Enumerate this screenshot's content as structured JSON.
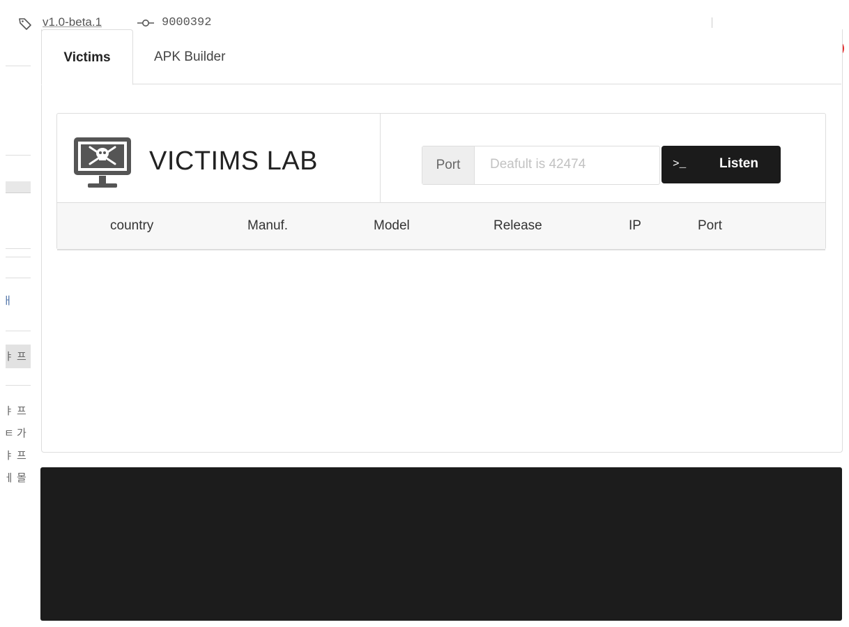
{
  "topbar": {
    "tag_icon": "tag-icon",
    "version": "v1.0-beta.1",
    "commit_icon": "git-commit-icon",
    "commit": "9000392"
  },
  "window_controls": {
    "colors": {
      "orange": "#f07a22",
      "red": "#e52a2a"
    }
  },
  "sidebar_fragments": [
    "ㅐ",
    "ㅑ 프",
    "ㅑ 프",
    "ㅌ 가",
    "ㅑ 프",
    "ㅔ 몰"
  ],
  "tabs": [
    {
      "label": "Victims",
      "active": true
    },
    {
      "label": "APK Builder",
      "active": false
    }
  ],
  "victims_lab": {
    "title": "VICTIMS LAB",
    "icon": "skull-monitor-icon",
    "port_label": "Port",
    "port_placeholder": "Deafult is 42474",
    "port_value": "",
    "listen_icon": ">_",
    "listen_label": "Listen"
  },
  "table": {
    "columns": [
      "country",
      "Manuf.",
      "Model",
      "Release",
      "IP",
      "Port"
    ],
    "rows": []
  },
  "colors": {
    "accent_dark": "#1b1b1b",
    "terminal_bg": "#1c1c1c"
  }
}
